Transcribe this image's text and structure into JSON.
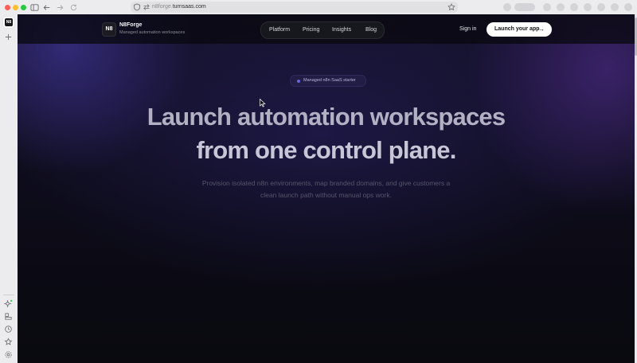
{
  "browser": {
    "url_prefix": "n8forge.",
    "url_domain": "turnsaas.com"
  },
  "sidebar": {
    "tab_logo": "N8"
  },
  "nav": {
    "logo_text": "N8",
    "brand": "N8Forge",
    "tagline": "Managed automation workspaces",
    "links": [
      "Platform",
      "Pricing",
      "Insights",
      "Blog"
    ],
    "signin": "Sign in",
    "cta": "Launch your app",
    "cta_arrow": "→"
  },
  "hero": {
    "badge": "Managed n8n SaaS starter",
    "title_line1": "Launch automation workspaces",
    "title_line2": "from one control plane.",
    "subtitle_line1": "Provision isolated n8n environments, map branded domains, and give customers a",
    "subtitle_line2": "clean launch path without manual ops work."
  },
  "colors": {
    "accent": "#6c63d9",
    "page_bg": "#0c0b17"
  }
}
